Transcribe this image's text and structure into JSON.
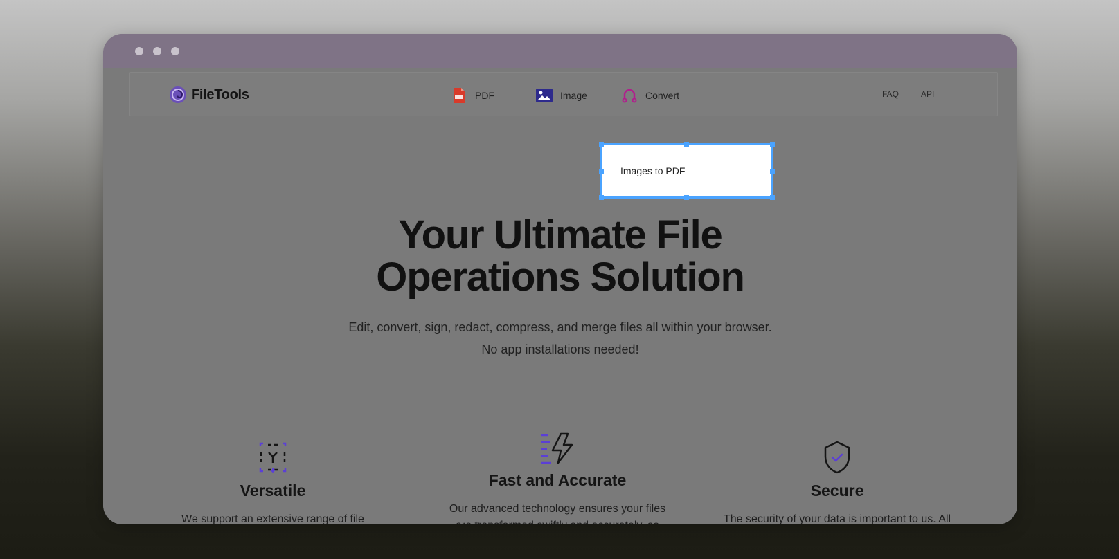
{
  "window": {
    "controls": [
      "close",
      "minimize",
      "maximize"
    ]
  },
  "navbar": {
    "brand": "FileTools",
    "items": [
      {
        "label": "PDF",
        "icon": "pdf-file-icon"
      },
      {
        "label": "Image",
        "icon": "image-icon"
      },
      {
        "label": "Convert",
        "icon": "convert-icon"
      }
    ],
    "right_links": [
      "FAQ",
      "API"
    ]
  },
  "dropdown": {
    "items": [
      "Images to PDF"
    ]
  },
  "hero": {
    "title_line1": "Your Ultimate File",
    "title_line2": "Operations Solution",
    "subtitle": "Edit, convert, sign, redact, compress, and merge files all within your browser. No app installations needed!"
  },
  "features": [
    {
      "title": "Versatile",
      "icon": "versatile-icon",
      "text": "We support an extensive range of file formats. From PDFs and Images to Ebooks. With more on the way!"
    },
    {
      "title": "Fast and Accurate",
      "icon": "lightning-icon",
      "text": "Our advanced technology ensures your files are transformed swiftly and accurately, so you can get back to"
    },
    {
      "title": "Secure",
      "icon": "shield-check-icon",
      "text": "The security of your data is important to us. All files are automatically deleted after processing to ensure privacy"
    }
  ],
  "colors": {
    "accent_purple": "#5b3fd6",
    "pdf_red": "#d83a2a",
    "image_indigo": "#2d2a8c",
    "convert_magenta": "#b0208c",
    "selection_blue": "#4aa3ff"
  }
}
